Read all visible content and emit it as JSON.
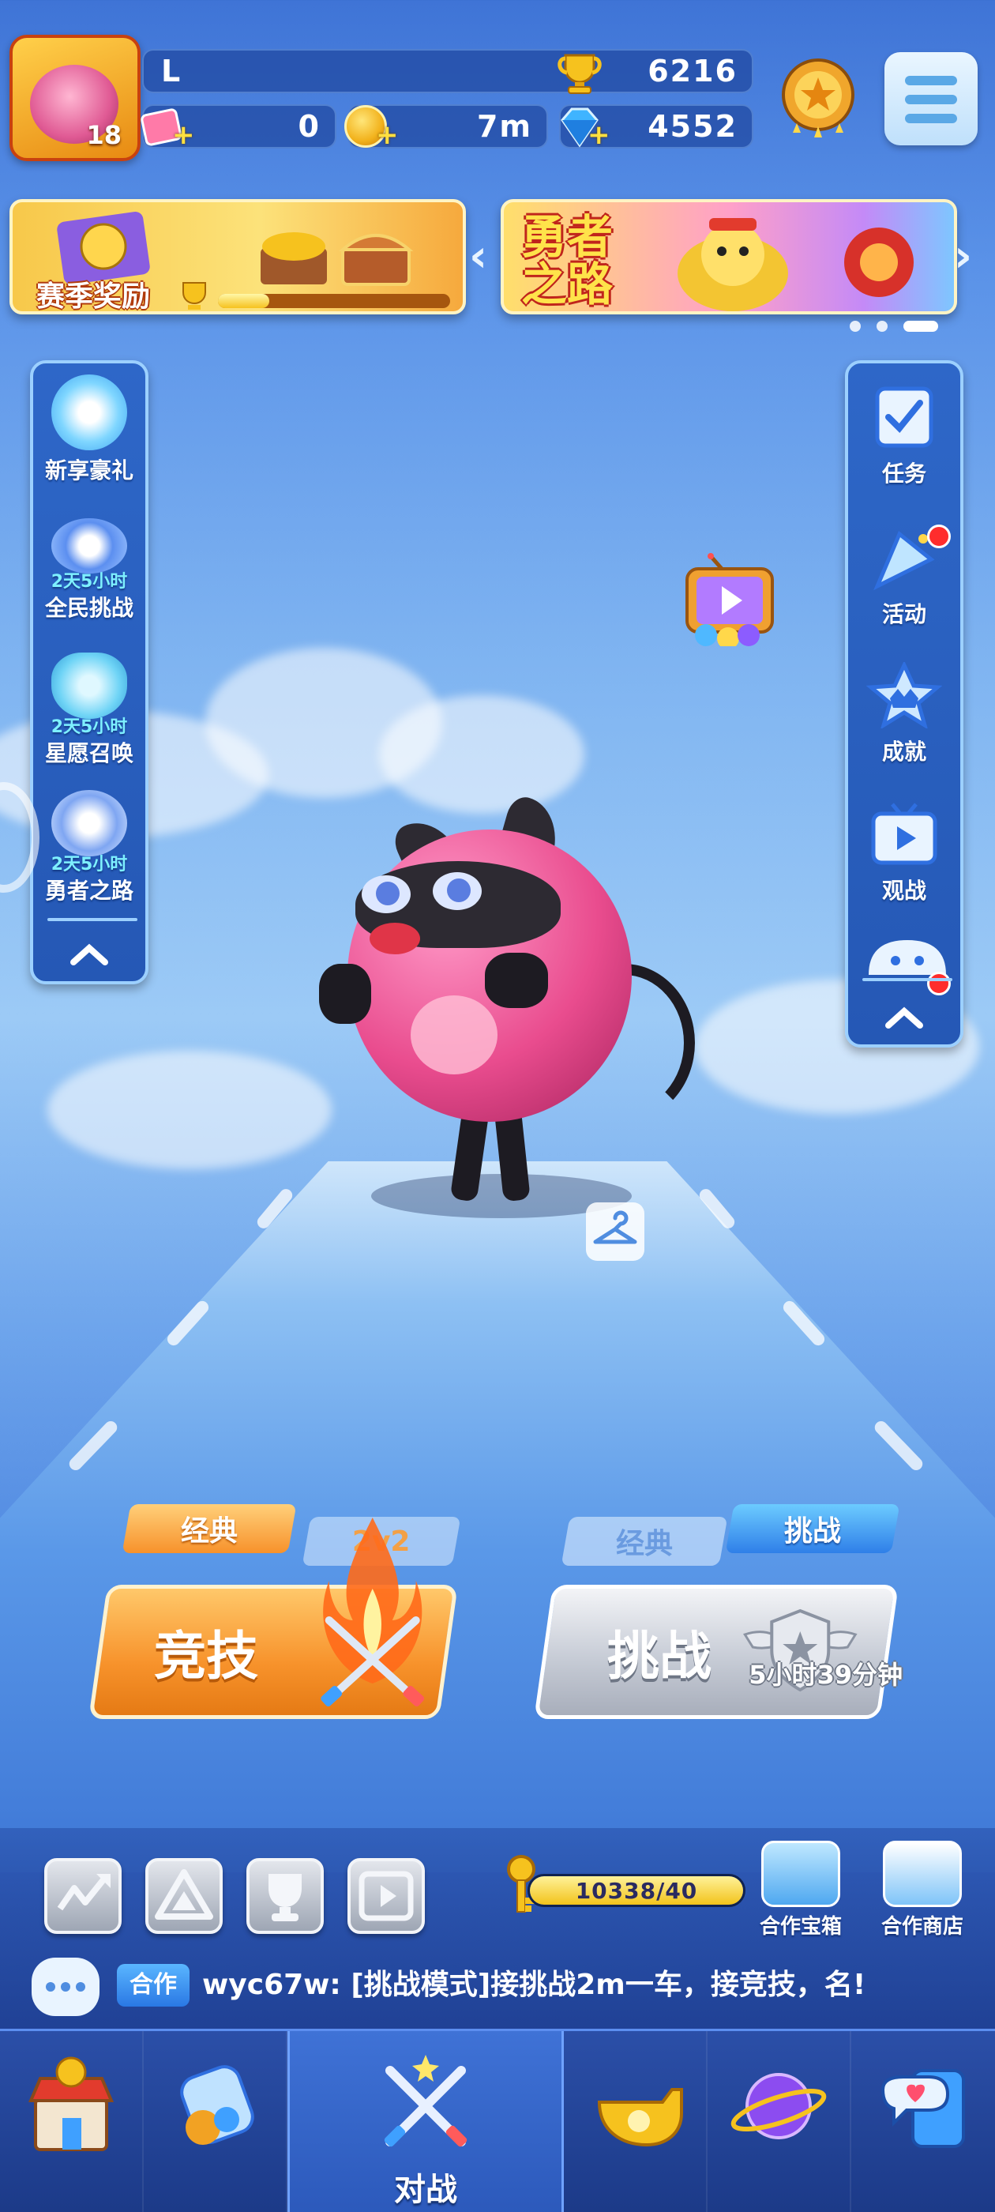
{
  "player": {
    "name": "L",
    "level": "18",
    "trophies": "6216",
    "tickets": "0",
    "coins_distance": "7m",
    "diamonds": "4552"
  },
  "banners": {
    "season_reward_label": "赛季奖励",
    "season_progress": 0.22,
    "hero_road_label": "勇者之路"
  },
  "left_panel": {
    "items": [
      {
        "label": "新享豪礼",
        "timer": ""
      },
      {
        "label": "全民挑战",
        "timer": "2天5小时"
      },
      {
        "label": "星愿召唤",
        "timer": "2天5小时"
      },
      {
        "label": "勇者之路",
        "timer": "2天5小时"
      }
    ]
  },
  "right_panel": {
    "items": [
      {
        "label": "任务",
        "badge": false
      },
      {
        "label": "活动",
        "badge": true
      },
      {
        "label": "成就",
        "badge": false
      },
      {
        "label": "观战",
        "badge": false
      }
    ]
  },
  "modes": {
    "left_tab_active": "经典",
    "left_tab_inactive": "2v2",
    "left_button": "竞技",
    "right_tab_inactive": "经典",
    "right_tab_active": "挑战",
    "right_button": "挑战",
    "right_timer": "5小时39分钟"
  },
  "coop": {
    "key_progress": "10338/40",
    "key_fill": 1.0,
    "chest_label": "合作宝箱",
    "shop_label": "合作商店"
  },
  "chat": {
    "tag": "合作",
    "message": "wyc67w: [挑战模式]接挑战2m一车，接竞技，名!"
  },
  "nav": {
    "active_label": "对战"
  },
  "colors": {
    "accent_orange": "#f7922b",
    "accent_blue": "#2f6fe0",
    "gold": "#f2c31b",
    "badge_red": "#ff2d2d"
  }
}
